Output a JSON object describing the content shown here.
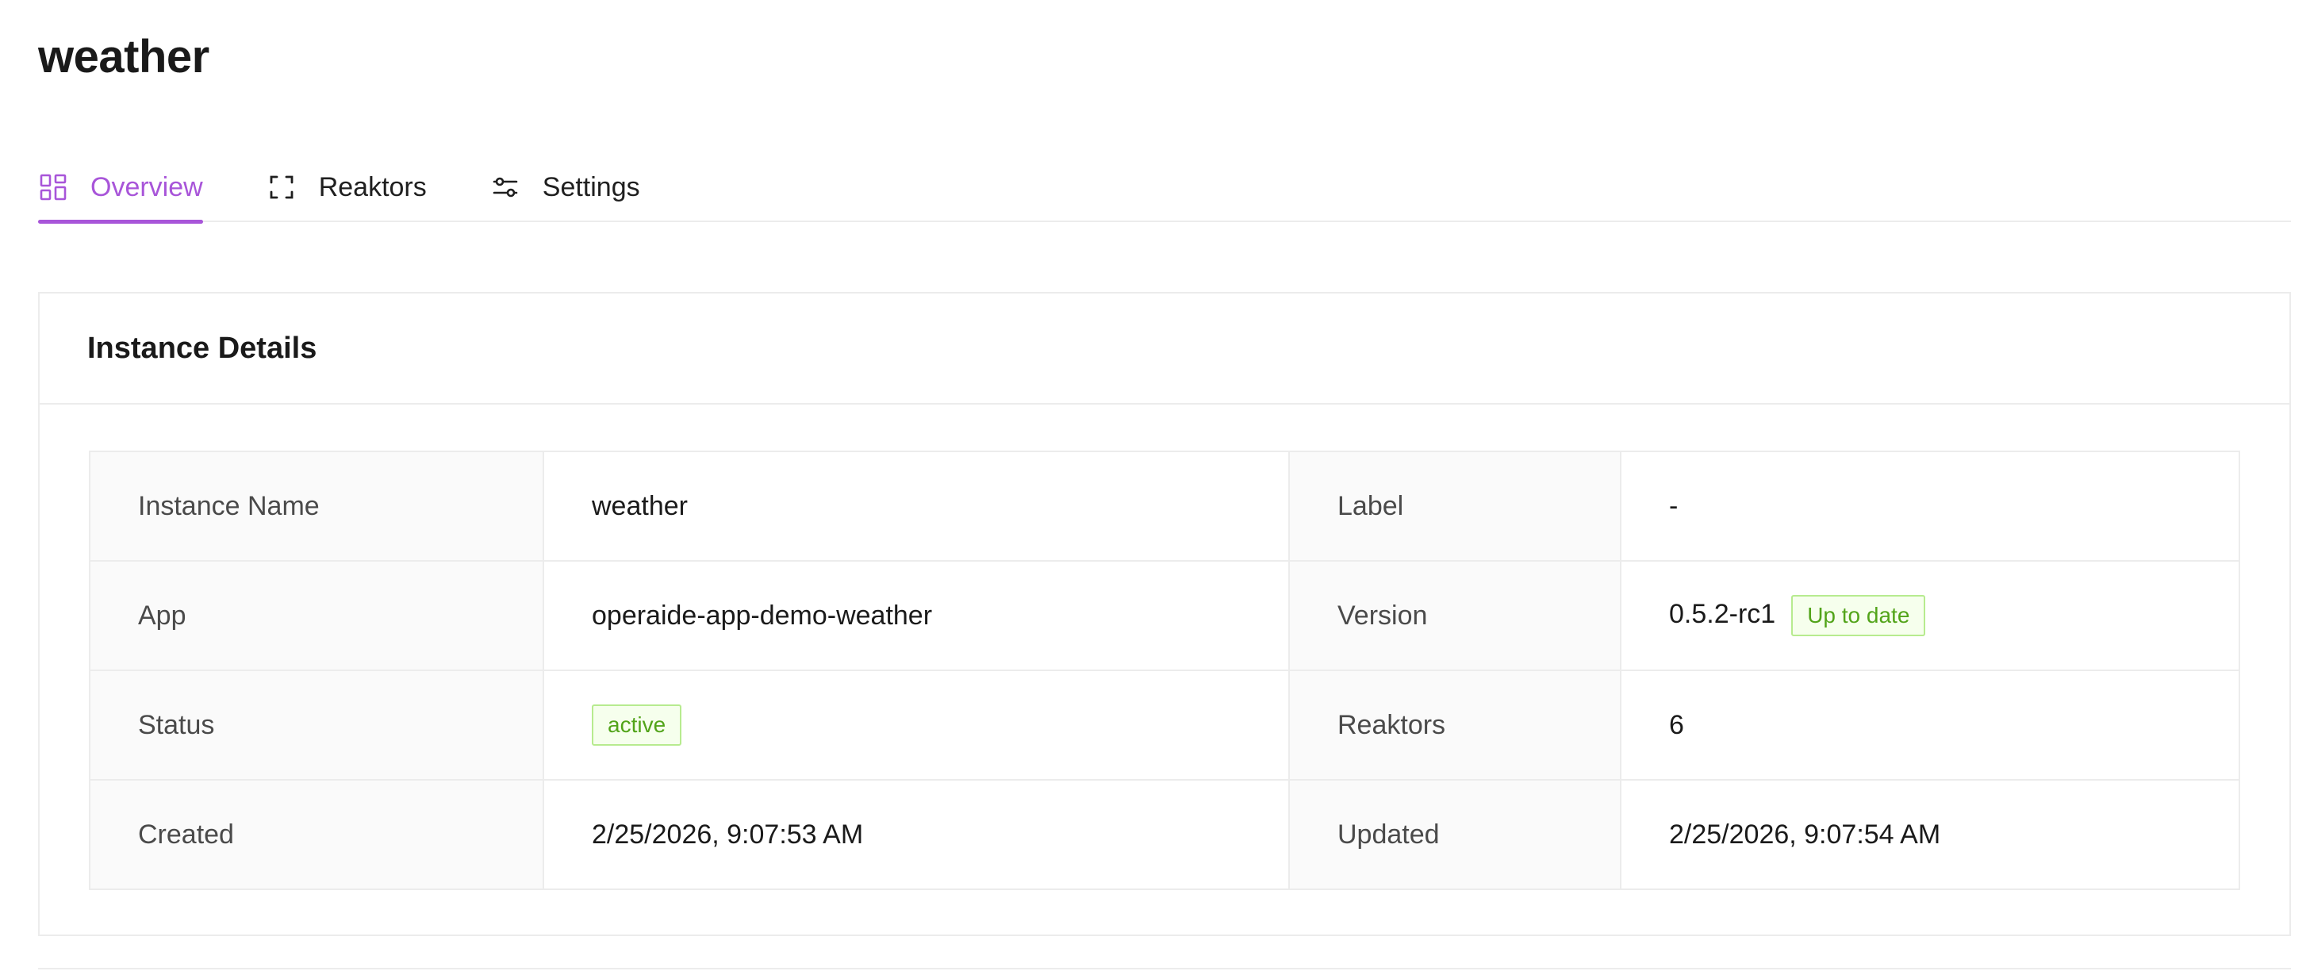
{
  "page": {
    "title": "weather"
  },
  "tabs": [
    {
      "label": "Overview",
      "icon": "dashboard-icon",
      "active": true
    },
    {
      "label": "Reaktors",
      "icon": "expand-frame-icon",
      "active": false
    },
    {
      "label": "Settings",
      "icon": "sliders-icon",
      "active": false
    }
  ],
  "card": {
    "title": "Instance Details",
    "rows": [
      {
        "label1": "Instance Name",
        "value1": "weather",
        "label2": "Label",
        "value2": "-"
      },
      {
        "label1": "App",
        "value1": "operaide-app-demo-weather",
        "label2": "Version",
        "value2": "0.5.2-rc1",
        "value2_tag": "Up to date"
      },
      {
        "label1": "Status",
        "value1_tag": "active",
        "label2": "Reaktors",
        "value2": "6"
      },
      {
        "label1": "Created",
        "value1": "2/25/2026, 9:07:53 AM",
        "label2": "Updated",
        "value2": "2/25/2026, 9:07:54 AM"
      }
    ]
  },
  "colors": {
    "accent": "#a855d9",
    "success_text": "#52a41a",
    "success_border": "#b7eb8f",
    "success_bg": "#f6ffed"
  }
}
